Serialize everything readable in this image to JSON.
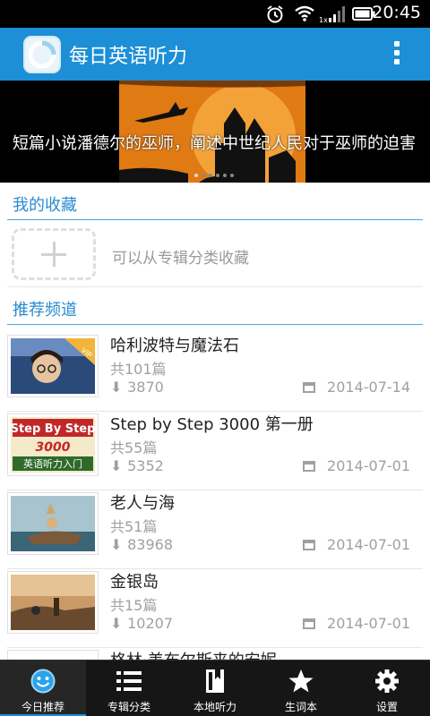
{
  "status_bar": {
    "time": "20:45"
  },
  "app": {
    "title": "每日英语听力"
  },
  "banner": {
    "text": "短篇小说潘德尔的巫师，阐述中世纪人民对于巫师的迫害"
  },
  "favorites": {
    "section_title": "我的收藏",
    "hint": "可以从专辑分类收藏"
  },
  "recommended": {
    "section_title": "推荐频道",
    "items": [
      {
        "title": "哈利波特与魔法石",
        "count": "共101篇",
        "downloads": "3870",
        "date": "2014-07-14",
        "badge": "VIP"
      },
      {
        "title": "Step by Step 3000 第一册",
        "count": "共55篇",
        "downloads": "5352",
        "date": "2014-07-01",
        "thumb_text_1": "Step By Step",
        "thumb_text_2": "3000",
        "thumb_text_3": "英语听力入门"
      },
      {
        "title": "老人与海",
        "count": "共51篇",
        "downloads": "83968",
        "date": "2014-07-01"
      },
      {
        "title": "金银岛",
        "count": "共15篇",
        "downloads": "10207",
        "date": "2014-07-01"
      },
      {
        "title": "格林·美布尔斯来的安妮",
        "count": "",
        "downloads": "",
        "date": ""
      }
    ]
  },
  "tabs": [
    {
      "label": "今日推荐",
      "icon": "smiley-icon",
      "active": true
    },
    {
      "label": "专辑分类",
      "icon": "list-icon",
      "active": false
    },
    {
      "label": "本地听力",
      "icon": "book-icon",
      "active": false
    },
    {
      "label": "生词本",
      "icon": "star-icon",
      "active": false
    },
    {
      "label": "设置",
      "icon": "gear-icon",
      "active": false
    }
  ],
  "colors": {
    "accent": "#1c8fd6",
    "section": "#2a8bd0",
    "tabbar": "#161616"
  }
}
